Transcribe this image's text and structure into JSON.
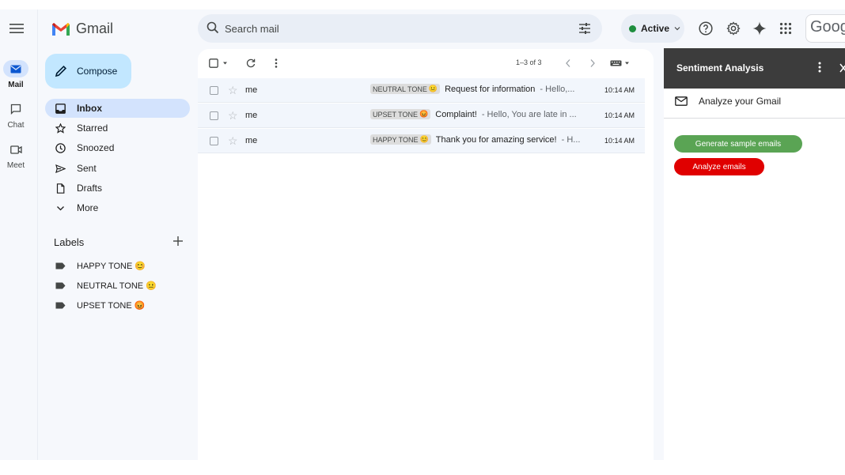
{
  "app": {
    "name": "Gmail"
  },
  "rail": {
    "items": [
      {
        "label": "Mail",
        "icon": "mail-icon",
        "active": true
      },
      {
        "label": "Chat",
        "icon": "chat-icon",
        "active": false
      },
      {
        "label": "Meet",
        "icon": "video-icon",
        "active": false
      }
    ]
  },
  "search": {
    "placeholder": "Search mail"
  },
  "status": {
    "label": "Active",
    "color": "#1e8e3e"
  },
  "account": {
    "label": "Goog"
  },
  "compose": {
    "label": "Compose"
  },
  "nav": {
    "items": [
      {
        "label": "Inbox",
        "icon": "inbox-icon",
        "active": true
      },
      {
        "label": "Starred",
        "icon": "star-icon",
        "active": false
      },
      {
        "label": "Snoozed",
        "icon": "clock-icon",
        "active": false
      },
      {
        "label": "Sent",
        "icon": "send-icon",
        "active": false
      },
      {
        "label": "Drafts",
        "icon": "draft-icon",
        "active": false
      },
      {
        "label": "More",
        "icon": "chevron-down-icon",
        "active": false
      }
    ]
  },
  "labels": {
    "title": "Labels",
    "items": [
      {
        "label": "HAPPY TONE",
        "emoji": "😊"
      },
      {
        "label": "NEUTRAL TONE",
        "emoji": "😐"
      },
      {
        "label": "UPSET TONE",
        "emoji": "😡"
      }
    ]
  },
  "list": {
    "pagination": "1–3 of 3",
    "emails": [
      {
        "sender": "me",
        "tag": "NEUTRAL TONE",
        "tag_emoji": "😐",
        "subject": "Request for information",
        "snippet": "- Hello,...",
        "time": "10:14 AM"
      },
      {
        "sender": "me",
        "tag": "UPSET TONE",
        "tag_emoji": "😡",
        "subject": "Complaint!",
        "snippet": "- Hello, You are late in ...",
        "time": "10:14 AM"
      },
      {
        "sender": "me",
        "tag": "HAPPY TONE",
        "tag_emoji": "😊",
        "subject": "Thank you for amazing service!",
        "snippet": "- H...",
        "time": "10:14 AM"
      }
    ]
  },
  "panel": {
    "title": "Sentiment Analysis",
    "subtitle": "Analyze your Gmail",
    "buttons": [
      {
        "label": "Generate sample emails",
        "color": "#5aa454"
      },
      {
        "label": "Analyze emails",
        "color": "#e00000"
      }
    ]
  }
}
